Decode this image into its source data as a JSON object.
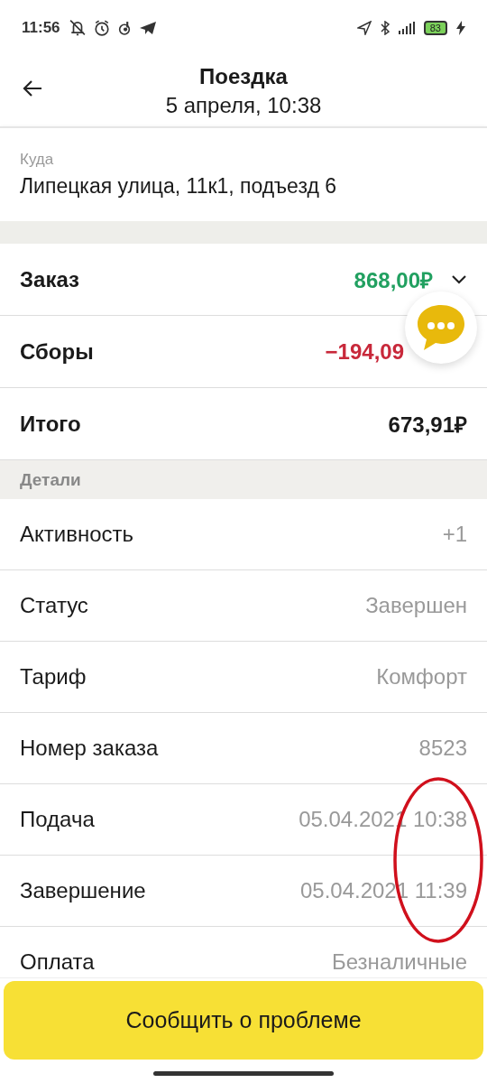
{
  "status_bar": {
    "time": "11:56",
    "battery": "83"
  },
  "header": {
    "title": "Поездка",
    "subtitle": "5 апреля, 10:38"
  },
  "destination": {
    "label": "Куда",
    "value": "Липецкая улица, 11к1, подъезд 6"
  },
  "totals": [
    {
      "label": "Заказ",
      "value": "868,00₽",
      "kind": "income",
      "expanded": false
    },
    {
      "label": "Сборы",
      "value": "−194,09",
      "kind": "fee"
    },
    {
      "label": "Итого",
      "value": "673,91₽",
      "kind": "total"
    }
  ],
  "details": {
    "title": "Детали",
    "rows": [
      {
        "label": "Активность",
        "value": "+1"
      },
      {
        "label": "Статус",
        "value": "Завершен"
      },
      {
        "label": "Тариф",
        "value": "Комфорт"
      },
      {
        "label": "Номер заказа",
        "value": "8523"
      },
      {
        "label": "Подача",
        "value": "05.04.2021 10:38"
      },
      {
        "label": "Завершение",
        "value": "05.04.2021 11:39"
      },
      {
        "label": "Оплата",
        "value": "Безналичные"
      }
    ]
  },
  "report_button": "Сообщить о проблеме"
}
